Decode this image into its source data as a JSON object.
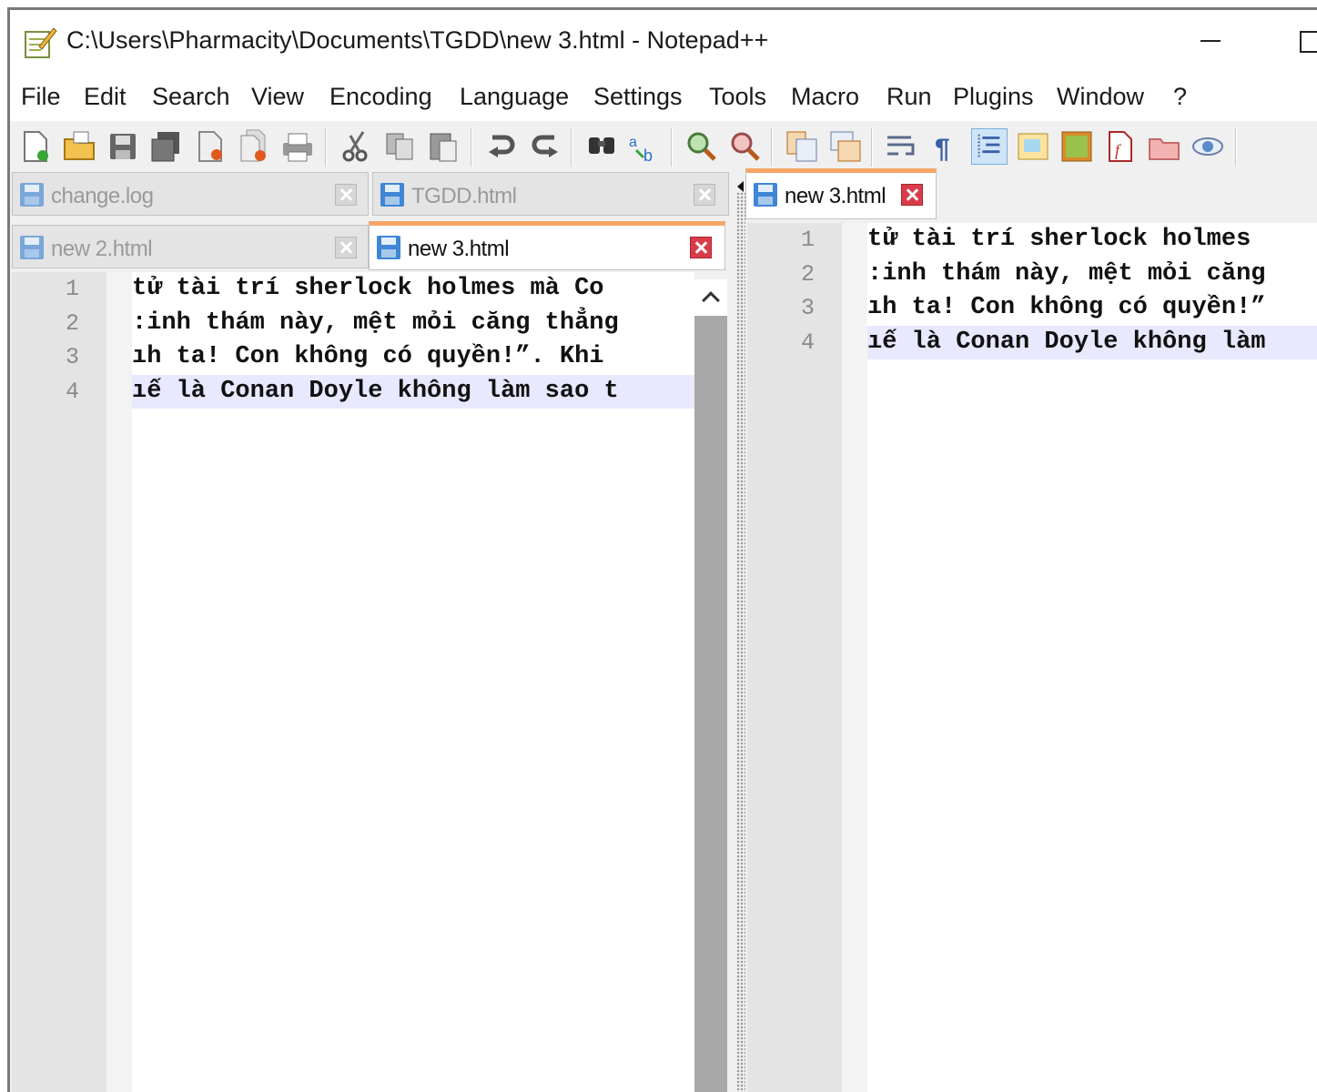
{
  "window": {
    "title": "C:\\Users\\Pharmacity\\Documents\\TGDD\\new 3.html - Notepad++"
  },
  "menu": [
    {
      "key": "file",
      "label": "File"
    },
    {
      "key": "edit",
      "label": "Edit"
    },
    {
      "key": "search",
      "label": "Search"
    },
    {
      "key": "view",
      "label": "View"
    },
    {
      "key": "encoding",
      "label": "Encoding"
    },
    {
      "key": "language",
      "label": "Language"
    },
    {
      "key": "settings",
      "label": "Settings"
    },
    {
      "key": "tools",
      "label": "Tools"
    },
    {
      "key": "macro",
      "label": "Macro"
    },
    {
      "key": "run",
      "label": "Run"
    },
    {
      "key": "plugins",
      "label": "Plugins"
    },
    {
      "key": "window",
      "label": "Window"
    },
    {
      "key": "help",
      "label": "?"
    }
  ],
  "toolbar_icons": [
    "new-file-icon",
    "open-file-icon",
    "save-icon",
    "save-all-icon",
    "close-icon",
    "close-all-icon",
    "print-icon",
    "cut-icon",
    "copy-icon",
    "paste-icon",
    "undo-icon",
    "redo-icon",
    "find-icon",
    "replace-icon",
    "zoom-in-icon",
    "zoom-out-icon",
    "sync-vertical-icon",
    "sync-horizontal-icon",
    "word-wrap-icon",
    "show-all-characters-icon",
    "indent-guide-icon",
    "document-map-icon",
    "function-list-icon",
    "folder-workspace-icon",
    "monitoring-icon",
    "eye-icon"
  ],
  "left_view": {
    "tabs_row1": [
      {
        "label": "change.log"
      },
      {
        "label": "TGDD.html"
      }
    ],
    "tabs_row2": [
      {
        "label": "new 2.html"
      },
      {
        "label": "new 3.html"
      }
    ],
    "line_numbers": [
      "1",
      "2",
      "3",
      "4"
    ],
    "lines": [
      " tử tài trí sherlock holmes mà Co",
      ":inh thám này, mệt mỏi căng thẳng",
      "ıh ta! Con không có quyền!”. Khi",
      "ıế là Conan Doyle không làm sao t"
    ]
  },
  "right_view": {
    "tabs": [
      {
        "label": "new 3.html"
      }
    ],
    "line_numbers": [
      "1",
      "2",
      "3",
      "4"
    ],
    "lines": [
      " tử tài trí sherlock holmes",
      ":inh thám này, mệt mỏi căng",
      "ıh ta! Con không có quyền!”",
      "ıế là Conan Doyle không làm"
    ]
  },
  "colors": {
    "active_tab_accent": "#f7a565",
    "current_line": "#e8e8ff",
    "gutter": "#e4e4e4",
    "close_active": "#d83c4b"
  }
}
